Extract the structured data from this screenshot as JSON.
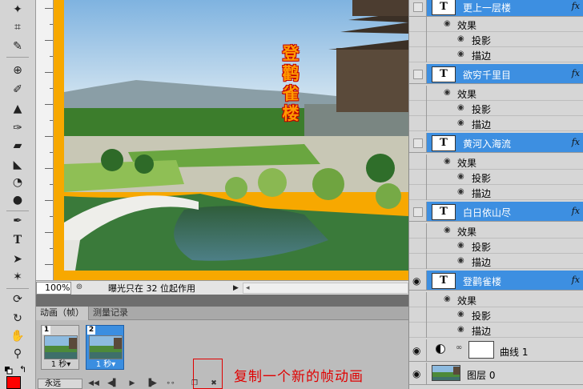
{
  "toolbox": {
    "tools": [
      "magic-wand-icon",
      "crop-icon",
      "eyedropper-icon",
      "healing-brush-icon",
      "brush-icon",
      "clone-stamp-icon",
      "history-brush-icon",
      "eraser-icon",
      "paint-bucket-icon",
      "blur-icon",
      "dodge-icon",
      "pen-icon",
      "type-icon",
      "path-select-icon",
      "custom-shape-icon",
      "3d-rotate-icon",
      "3d-orbit-icon",
      "hand-icon",
      "zoom-icon"
    ],
    "foreground_color": "#ff0000"
  },
  "document": {
    "title_vertical": "登鹳雀楼",
    "canvas_border_color": "#f7a800"
  },
  "status_bar": {
    "zoom": "100%",
    "info": "曝光只在 32 位起作用"
  },
  "animation_panel": {
    "tabs": [
      "动画（帧）",
      "测量记录"
    ],
    "frames": [
      {
        "number": "1",
        "delay": "1 秒▾"
      },
      {
        "number": "2",
        "delay": "1 秒▾"
      }
    ],
    "loop": "永远"
  },
  "annotation": {
    "text": "复制一个新的帧动画",
    "color": "#e00000"
  },
  "layers_panel": {
    "text_layers": [
      {
        "name": "更上一层楼",
        "fx": "fx",
        "effects": "效果",
        "sub_effects": [
          "投影",
          "描边"
        ],
        "visible": false
      },
      {
        "name": "欲穷千里目",
        "fx": "fx",
        "effects": "效果",
        "sub_effects": [
          "投影",
          "描边"
        ],
        "visible": false
      },
      {
        "name": "黄河入海流",
        "fx": "fx",
        "effects": "效果",
        "sub_effects": [
          "投影",
          "描边"
        ],
        "visible": false
      },
      {
        "name": "白日依山尽",
        "fx": "fx",
        "effects": "效果",
        "sub_effects": [
          "投影",
          "描边"
        ],
        "visible": false
      },
      {
        "name": "登鹳雀楼",
        "fx": "fx",
        "effects": "效果",
        "sub_effects": [
          "投影",
          "描边"
        ],
        "visible": true
      }
    ],
    "type_thumb_letter": "T",
    "curves_layer": "曲线 1",
    "image_layer": "图层 0",
    "selection_color": "#3d8fe1"
  }
}
